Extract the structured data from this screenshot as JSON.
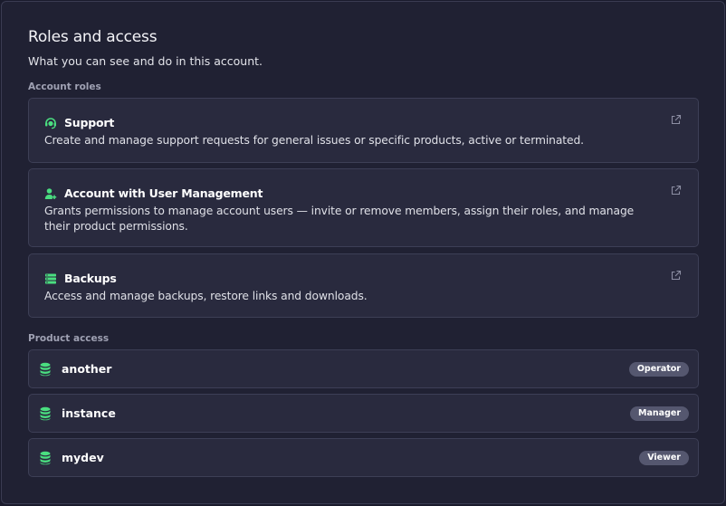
{
  "header": {
    "title": "Roles and access",
    "subtitle": "What you can see and do in this account."
  },
  "account_roles": {
    "label": "Account roles",
    "items": [
      {
        "name": "Support",
        "icon": "headset-icon",
        "description": "Create and manage support requests for general issues or specific products, active or terminated."
      },
      {
        "name": "Account with User Management",
        "icon": "user-plus-icon",
        "description": "Grants permissions to manage account users — invite or remove members, assign their roles, and manage their product permissions."
      },
      {
        "name": "Backups",
        "icon": "server-stack-icon",
        "description": "Access and manage backups, restore links and downloads."
      }
    ]
  },
  "product_access": {
    "label": "Product access",
    "items": [
      {
        "name": "another",
        "role": "Operator"
      },
      {
        "name": "instance",
        "role": "Manager"
      },
      {
        "name": "mydev",
        "role": "Viewer"
      }
    ]
  },
  "colors": {
    "accent": "#4ade80",
    "background": "#202133",
    "card": "#292a3e",
    "badge": "#55576f"
  }
}
